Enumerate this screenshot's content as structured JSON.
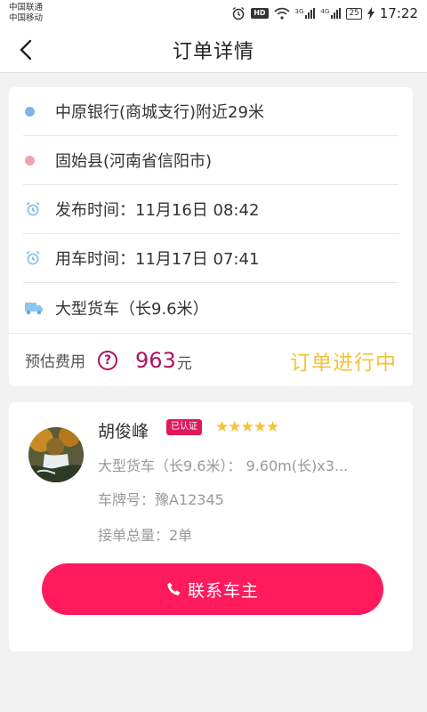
{
  "status_bar": {
    "carrier_1": "中国联通",
    "carrier_2": "中国移动",
    "hd": "HD",
    "net_1": "3G",
    "net_2": "4G",
    "battery": "25",
    "time": "17:22"
  },
  "header": {
    "title": "订单详情"
  },
  "order": {
    "origin": "中原银行(商城支行)附近29米",
    "destination": "固始县(河南省信阳市)",
    "publish_time": "发布时间：11月16日 08:42",
    "use_time": "用车时间：11月17日 07:41",
    "vehicle_type": "大型货车（长9.6米）",
    "fee_label": "预估费用",
    "fee_amount": "963",
    "fee_unit": "元",
    "status": "订单进行中",
    "colors": {
      "origin_dot": "#7fb3ec",
      "dest_dot": "#f2a3ad",
      "fee": "#b0125e",
      "status": "#f3c33a"
    }
  },
  "driver": {
    "name": "胡俊峰",
    "verified_badge": "已认证",
    "stars": "★★★★★",
    "vehicle": "大型货车（长9.6米）：  9.60m(长)x3...",
    "plate": "车牌号：豫A12345",
    "total_orders": "接单总量：2单",
    "contact_label": "联系车主",
    "colors": {
      "button": "#ff1a5e",
      "badge": "#e0185f"
    }
  }
}
